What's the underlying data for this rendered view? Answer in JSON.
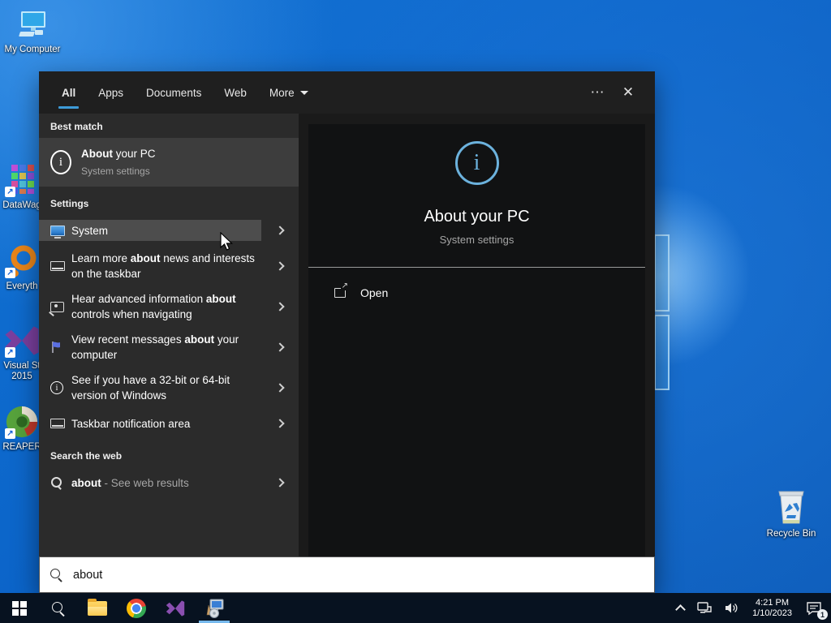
{
  "desktop": {
    "icons": {
      "my_computer": "My Computer",
      "datawag": "DataWag",
      "everything": "Everyth",
      "visual_studio_line1": "Visual St",
      "visual_studio_line2": "2015",
      "reaper": "REAPER",
      "recycle_bin": "Recycle Bin"
    }
  },
  "panel": {
    "tabs": {
      "all": "All",
      "apps": "Apps",
      "documents": "Documents",
      "web": "Web",
      "more": "More"
    },
    "window_controls": {
      "ellipsis": "⋯",
      "close": "✕"
    },
    "best_match": {
      "header": "Best match",
      "title_bold": "About",
      "title_rest": " your PC",
      "subtitle": "System settings"
    },
    "settings": {
      "header": "Settings",
      "rows": [
        {
          "pre": "System",
          "bold": "",
          "post": ""
        },
        {
          "pre": "Learn more ",
          "bold": "about",
          "post": " news and interests on the taskbar"
        },
        {
          "pre": "Hear advanced information ",
          "bold": "about",
          "post": " controls when navigating"
        },
        {
          "pre": "View recent messages ",
          "bold": "about",
          "post": " your computer"
        },
        {
          "pre": "See if you have a 32-bit or 64-bit version of Windows",
          "bold": "",
          "post": ""
        },
        {
          "pre": "Taskbar notification area",
          "bold": "",
          "post": ""
        }
      ]
    },
    "web": {
      "header": "Search the web",
      "query": "about",
      "suffix": " - See web results"
    },
    "preview": {
      "title": "About your PC",
      "subtitle": "System settings",
      "open_label": "Open"
    },
    "search_box": {
      "value": "about"
    }
  },
  "taskbar": {
    "clock_time": "4:21 PM",
    "clock_date": "1/10/2023",
    "notification_badge": "1"
  },
  "colors": {
    "accent": "#3d9bd8",
    "info_icon_blue": "#6cb2dd",
    "active_underline": "#76b9ed"
  }
}
